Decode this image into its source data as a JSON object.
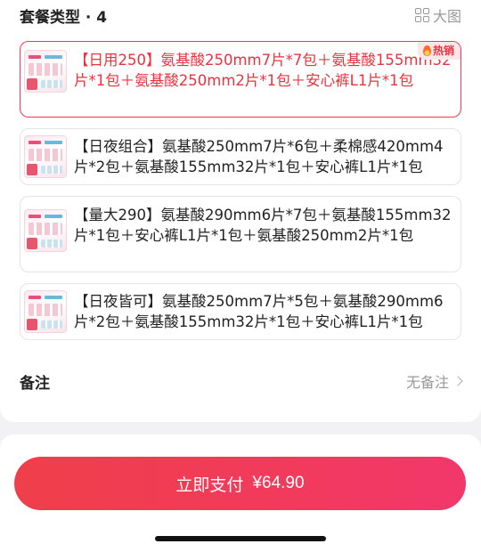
{
  "header": {
    "title": "套餐类型 · 4",
    "big_image_label": "大图"
  },
  "options": [
    {
      "text": "【日用250】氨基酸250mm7片*7包＋氨基酸155mm32片*1包＋氨基酸250mm2片*1包＋安心裤L1片*1包",
      "badge": "热销",
      "selected": true
    },
    {
      "text": "【日夜组合】氨基酸250mm7片*6包＋柔棉感420mm4片*2包＋氨基酸155mm32片*1包＋安心裤L1片*1包",
      "selected": false
    },
    {
      "text": "【量大290】氨基酸290mm6片*7包＋氨基酸155mm32片*1包＋安心裤L1片*1包＋氨基酸250mm2片*1包",
      "selected": false
    },
    {
      "text": "【日夜皆可】氨基酸250mm7片*5包＋氨基酸290mm6片*2包＋氨基酸155mm32片*1包＋安心裤L1片*1包",
      "selected": false
    }
  ],
  "remark": {
    "label": "备注",
    "value": "无备注"
  },
  "pay_button": {
    "label": "立即支付",
    "amount": "¥64.90"
  },
  "colors": {
    "accent": "#e8333f",
    "button_gradient_start": "#ef3f4a",
    "button_gradient_end": "#f2386b"
  }
}
